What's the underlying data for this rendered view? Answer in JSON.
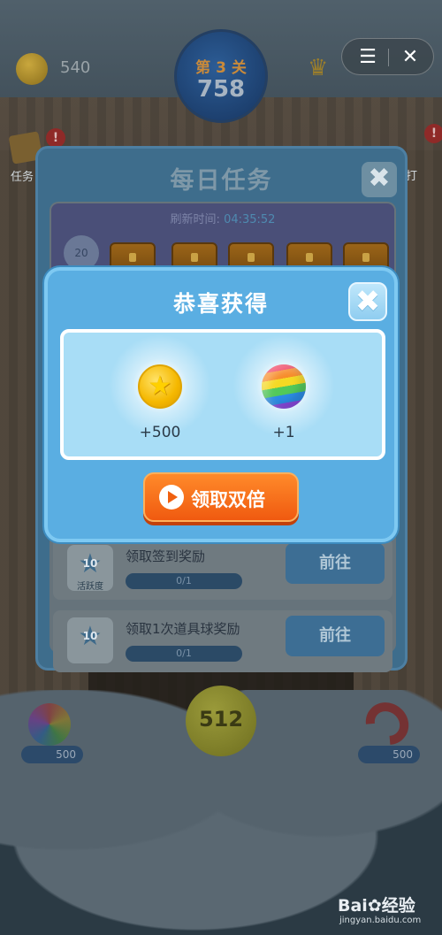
{
  "hud": {
    "coins": "540",
    "level_label": "第 3 关",
    "score": "758",
    "right_value": "758"
  },
  "top_controls": {
    "menu_glyph": "☰",
    "close_glyph": "✕"
  },
  "side": {
    "left_label": "任务",
    "left_badge": "!",
    "right_label": "打",
    "right_badge": "!"
  },
  "daily_tasks": {
    "title": "每日任务",
    "close_glyph": "✖",
    "refresh_label": "刷新时间:",
    "refresh_time": "04:35:52",
    "progress_star": "20",
    "chest_count": 5,
    "tasks": [
      {
        "points": "10",
        "tag": "活跃度",
        "name": "领取签到奖励",
        "progress": "0/1",
        "button": "前往"
      },
      {
        "points": "10",
        "tag": "",
        "name": "领取1次道具球奖励",
        "progress": "0/1",
        "button": "前往"
      }
    ]
  },
  "reward_dialog": {
    "title": "恭喜获得",
    "close_glyph": "✖",
    "items": [
      {
        "icon": "gold-star-coin-icon",
        "amount": "+500"
      },
      {
        "icon": "rainbow-ball-icon",
        "amount": "+1"
      }
    ],
    "double_button": "领取双倍"
  },
  "bottom": {
    "center_ball": "512",
    "left_price": "500",
    "right_price": "500"
  },
  "watermark": {
    "logo_left": "Bai",
    "logo_right": "经验",
    "url": "jingyan.baidu.com"
  },
  "colors": {
    "dialog_blue": "#5aaee2",
    "button_orange": "#f05a10",
    "coin_gold": "#f5b800"
  }
}
